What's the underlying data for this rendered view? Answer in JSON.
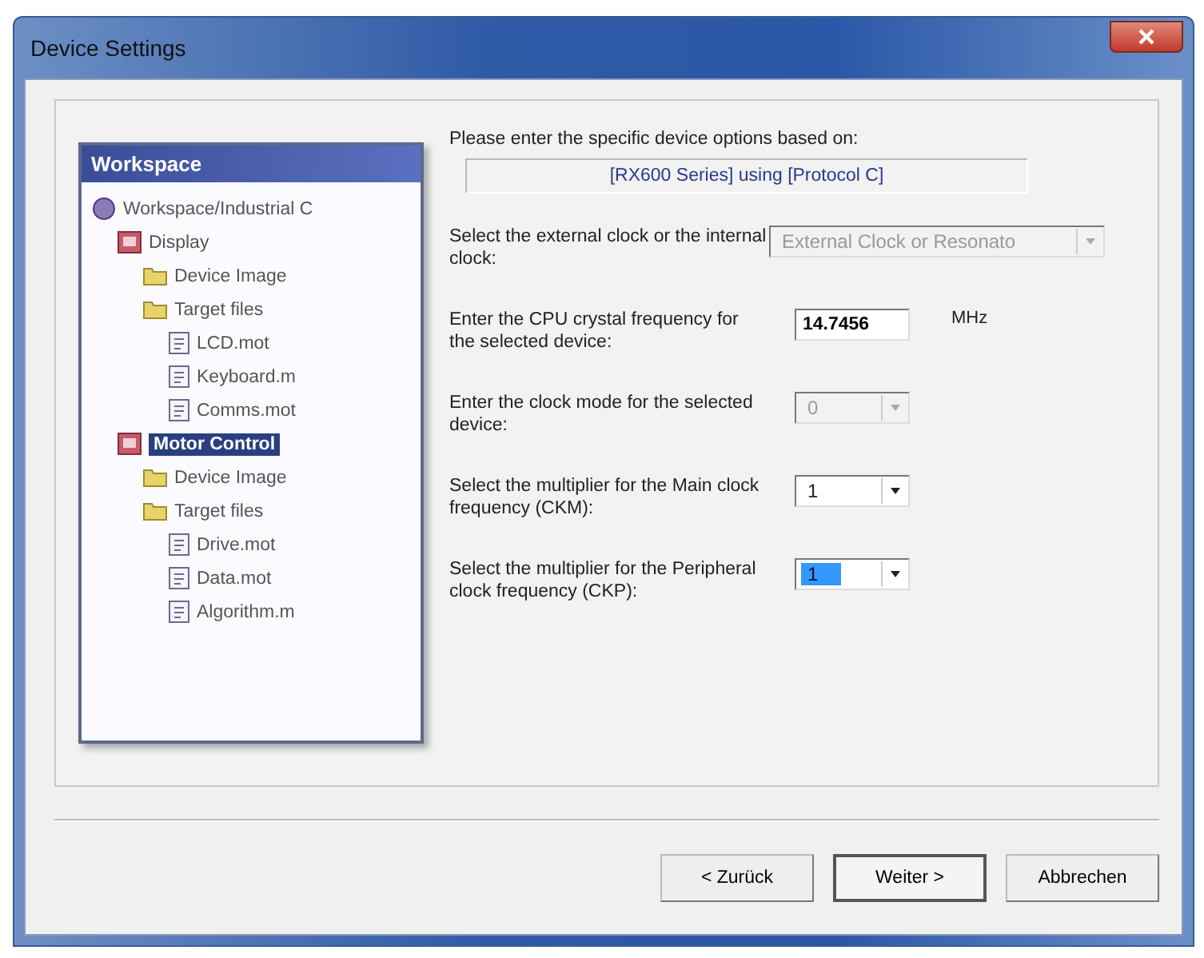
{
  "window": {
    "title": "Device Settings"
  },
  "illustration": {
    "title": "Workspace",
    "tree": [
      {
        "label": "Workspace/Industrial C",
        "kind": "workspace",
        "selected": false,
        "children": [
          {
            "label": "Display",
            "kind": "module",
            "selected": false,
            "children": [
              {
                "label": "Device Image",
                "kind": "folder",
                "selected": false
              },
              {
                "label": "Target files",
                "kind": "folder",
                "selected": false,
                "children": [
                  {
                    "label": "LCD.mot",
                    "kind": "file",
                    "selected": false
                  },
                  {
                    "label": "Keyboard.m",
                    "kind": "file",
                    "selected": false
                  },
                  {
                    "label": "Comms.mot",
                    "kind": "file",
                    "selected": false
                  }
                ]
              }
            ]
          },
          {
            "label": "Motor Control",
            "kind": "module",
            "selected": true,
            "children": [
              {
                "label": "Device Image",
                "kind": "folder",
                "selected": false
              },
              {
                "label": "Target files",
                "kind": "folder",
                "selected": false,
                "children": [
                  {
                    "label": "Drive.mot",
                    "kind": "file",
                    "selected": false
                  },
                  {
                    "label": "Data.mot",
                    "kind": "file",
                    "selected": false
                  },
                  {
                    "label": "Algorithm.m",
                    "kind": "file",
                    "selected": false
                  }
                ]
              }
            ]
          }
        ]
      }
    ]
  },
  "intro": "Please enter the specific device options based on:",
  "device_info": "[RX600 Series]  using  [Protocol C]",
  "settings": [
    {
      "label": "Select the external clock or the internal clock:",
      "kind": "select",
      "value": "External Clock or Resonato",
      "disabled": true,
      "focused": false
    },
    {
      "label": "Enter the CPU crystal frequency for the selected device:",
      "kind": "input",
      "value": "14.7456",
      "unit": "MHz",
      "disabled": false,
      "focused": false
    },
    {
      "label": "Enter the clock mode for the selected device:",
      "kind": "select",
      "value": "0",
      "disabled": true,
      "focused": false
    },
    {
      "label": "Select the multiplier for the Main clock frequency (CKM):",
      "kind": "select",
      "value": "1",
      "disabled": false,
      "focused": false
    },
    {
      "label": "Select the multiplier for the Peripheral clock frequency (CKP):",
      "kind": "select",
      "value": "1",
      "disabled": false,
      "focused": true
    }
  ],
  "buttons": [
    {
      "label": "< Zurück",
      "default": false
    },
    {
      "label": "Weiter >",
      "default": true
    },
    {
      "label": "Abbrechen",
      "default": false
    }
  ]
}
